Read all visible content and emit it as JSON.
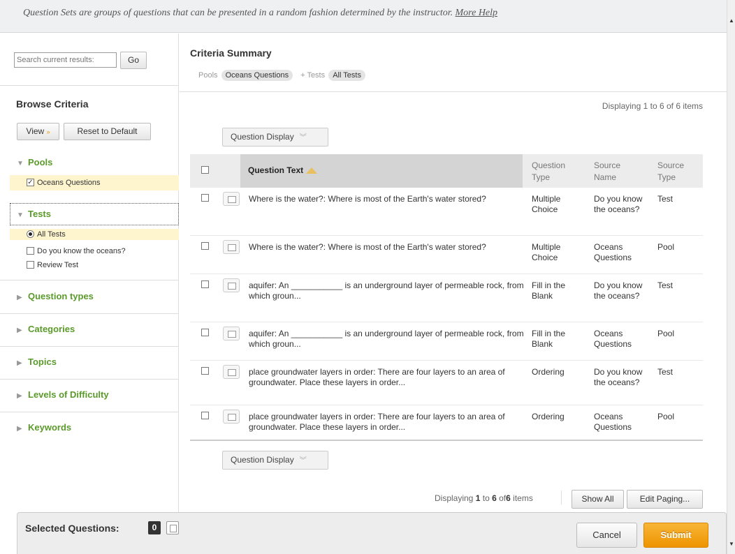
{
  "banner": {
    "text": "Question Sets are groups of questions that can be presented in a random fashion determined by the instructor.",
    "link": "More Help"
  },
  "search": {
    "placeholder": "Search current results:",
    "go_label": "Go"
  },
  "browse": {
    "title": "Browse Criteria",
    "view_label": "View",
    "reset_label": "Reset to Default",
    "pools": {
      "label": "Pools",
      "items": [
        {
          "label": "Oceans Questions",
          "checked": true
        }
      ]
    },
    "tests": {
      "label": "Tests",
      "items": [
        {
          "label": "All Tests",
          "kind": "radio",
          "checked": true
        },
        {
          "label": "Do you know the oceans?",
          "kind": "checkbox",
          "checked": false
        },
        {
          "label": "Review Test",
          "kind": "checkbox",
          "checked": false
        }
      ]
    },
    "collapsed": [
      "Question types",
      "Categories",
      "Topics",
      "Levels of Difficulty",
      "Keywords"
    ]
  },
  "summary": {
    "title": "Criteria Summary",
    "pools_label": "Pools",
    "pools_value": "Oceans Questions",
    "tests_label": "+ Tests",
    "tests_value": "All Tests"
  },
  "display_top": "Displaying 1 to 6 of 6 items",
  "question_display_label": "Question Display",
  "table": {
    "headers": {
      "text": "Question Text",
      "type_line1": "Question",
      "type_line2": "Type",
      "source_line1": "Source",
      "source_line2": "Name",
      "stype_line1": "Source",
      "stype_line2": "Type"
    },
    "rows": [
      {
        "text": "Where is the water?: Where is most of the Earth's water stored?",
        "type": "Multiple Choice",
        "source": "Do you know the oceans?",
        "stype": "Test"
      },
      {
        "text": "Where is the water?: Where is most of the Earth's water stored?",
        "type": "Multiple Choice",
        "source": "Oceans Questions",
        "stype": "Pool"
      },
      {
        "text": "aquifer: An ___________ is an underground layer of permeable rock, from which groun...",
        "type": "Fill in the Blank",
        "source": "Do you know the oceans?",
        "stype": "Test"
      },
      {
        "text": "aquifer: An ___________ is an underground layer of permeable rock, from which groun...",
        "type": "Fill in the Blank",
        "source": "Oceans Questions",
        "stype": "Pool"
      },
      {
        "text": "place groundwater layers in order: There are four layers to an area of groundwater. Place these layers in order...",
        "type": "Ordering",
        "source": "Do you know the oceans?",
        "stype": "Test"
      },
      {
        "text": "place groundwater layers in order: There are four layers to an area of groundwater. Place these layers in order...",
        "type": "Ordering",
        "source": "Oceans Questions",
        "stype": "Pool"
      }
    ]
  },
  "paging": {
    "prefix": "Displaying",
    "from": "1",
    "to_word": "to",
    "to": "6",
    "of_word": "of",
    "total": "6",
    "suffix": "items",
    "show_all": "Show All",
    "edit_paging": "Edit Paging..."
  },
  "footer": {
    "selected_label": "Selected Questions:",
    "selected_count": "0",
    "cancel": "Cancel",
    "submit": "Submit"
  },
  "colors": {
    "accent_green": "#5a9a2a",
    "submit_orange": "#ee9400",
    "highlight": "#fef5cf"
  }
}
